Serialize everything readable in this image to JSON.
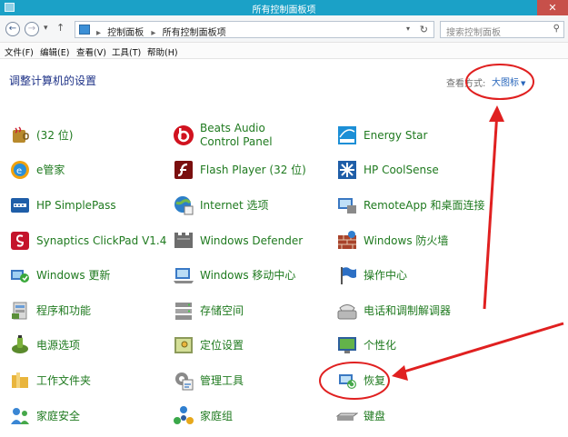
{
  "window": {
    "title": "所有控制面板项",
    "close_glyph": "✕"
  },
  "address": {
    "crumbs": [
      "控制面板",
      "所有控制面板项"
    ],
    "search_placeholder": "搜索控制面板"
  },
  "menu": [
    "文件(F)",
    "编辑(E)",
    "查看(V)",
    "工具(T)",
    "帮助(H)"
  ],
  "page": {
    "title": "调整计算机的设置",
    "view_by_label": "查看方式:",
    "view_by_value": "大图标"
  },
  "items": {
    "col1": [
      "(32 位)",
      "e管家",
      "HP SimplePass",
      "Synaptics ClickPad V1.4",
      "Windows 更新",
      "程序和功能",
      "电源选项",
      "工作文件夹",
      "家庭安全"
    ],
    "col2": [
      "Beats Audio Control Panel",
      "Flash Player (32 位)",
      "Internet 选项",
      "Windows Defender",
      "Windows 移动中心",
      "存储空间",
      "定位设置",
      "管理工具",
      "家庭组"
    ],
    "col3": [
      "Energy Star",
      "HP CoolSense",
      "RemoteApp 和桌面连接",
      "Windows 防火墙",
      "操作中心",
      "电话和调制解调器",
      "个性化",
      "恢复",
      "键盘"
    ]
  },
  "icons": {
    "col1": [
      "java-icon",
      "e-manager-icon",
      "hp-simplepass-icon",
      "synaptics-icon",
      "windows-update-icon",
      "programs-features-icon",
      "power-options-icon",
      "work-folders-icon",
      "family-safety-icon"
    ],
    "col2": [
      "beats-audio-icon",
      "flash-player-icon",
      "internet-options-icon",
      "windows-defender-icon",
      "mobility-center-icon",
      "storage-spaces-icon",
      "location-settings-icon",
      "admin-tools-icon",
      "homegroup-icon"
    ],
    "col3": [
      "energy-star-icon",
      "hp-coolsense-icon",
      "remoteapp-icon",
      "windows-firewall-icon",
      "action-center-icon",
      "phone-modem-icon",
      "personalization-icon",
      "recovery-icon",
      "keyboard-icon"
    ]
  },
  "colors": {
    "titlebar": "#1ba1c7",
    "item_text": "#1f7a1f",
    "link": "#2866bb",
    "annotation": "#e02020"
  }
}
